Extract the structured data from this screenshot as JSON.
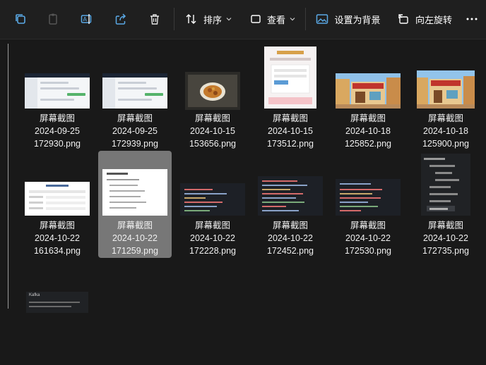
{
  "toolbar": {
    "buttons": [
      {
        "name": "copy",
        "icon": "copy-icon"
      },
      {
        "name": "paste",
        "icon": "paste-icon"
      },
      {
        "name": "rename",
        "icon": "rename-icon"
      },
      {
        "name": "share",
        "icon": "share-icon"
      },
      {
        "name": "delete",
        "icon": "trash-icon"
      }
    ],
    "sort_label": "排序",
    "view_label": "查看",
    "set_background_label": "设置为背景",
    "rotate_left_label": "向左旋转",
    "more_icon": "more-icon"
  },
  "colors": {
    "background": "#191919",
    "toolbar": "#1f1f1f",
    "selected_tile": "#777777",
    "accent": "#4cc2ff"
  },
  "files": [
    {
      "name": "屏幕截图",
      "date": "2024-09-25",
      "file": "172930.png",
      "thumb": "web-chat"
    },
    {
      "name": "屏幕截图",
      "date": "2024-09-25",
      "file": "172939.png",
      "thumb": "web-chat"
    },
    {
      "name": "屏幕截图",
      "date": "2024-10-15",
      "file": "153656.png",
      "thumb": "food-photo"
    },
    {
      "name": "屏幕截图",
      "date": "2024-10-15",
      "file": "173512.png",
      "thumb": "login-form"
    },
    {
      "name": "屏幕截图",
      "date": "2024-10-18",
      "file": "125852.png",
      "thumb": "storefront"
    },
    {
      "name": "屏幕截图",
      "date": "2024-10-18",
      "file": "125900.png",
      "thumb": "storefront"
    },
    {
      "name": "屏幕截图",
      "date": "2024-10-22",
      "file": "161634.png",
      "thumb": "web-form"
    },
    {
      "name": "屏幕截图",
      "date": "2024-10-22",
      "file": "171259.png",
      "thumb": "document",
      "selected": true
    },
    {
      "name": "屏幕截图",
      "date": "2024-10-22",
      "file": "172228.png",
      "thumb": "code"
    },
    {
      "name": "屏幕截图",
      "date": "2024-10-22",
      "file": "172452.png",
      "thumb": "code"
    },
    {
      "name": "屏幕截图",
      "date": "2024-10-22",
      "file": "172530.png",
      "thumb": "code"
    },
    {
      "name": "屏幕截图",
      "date": "2024-10-22",
      "file": "172735.png",
      "thumb": "tree"
    }
  ],
  "partial_tile": {
    "thumb_title": "Kafka"
  }
}
